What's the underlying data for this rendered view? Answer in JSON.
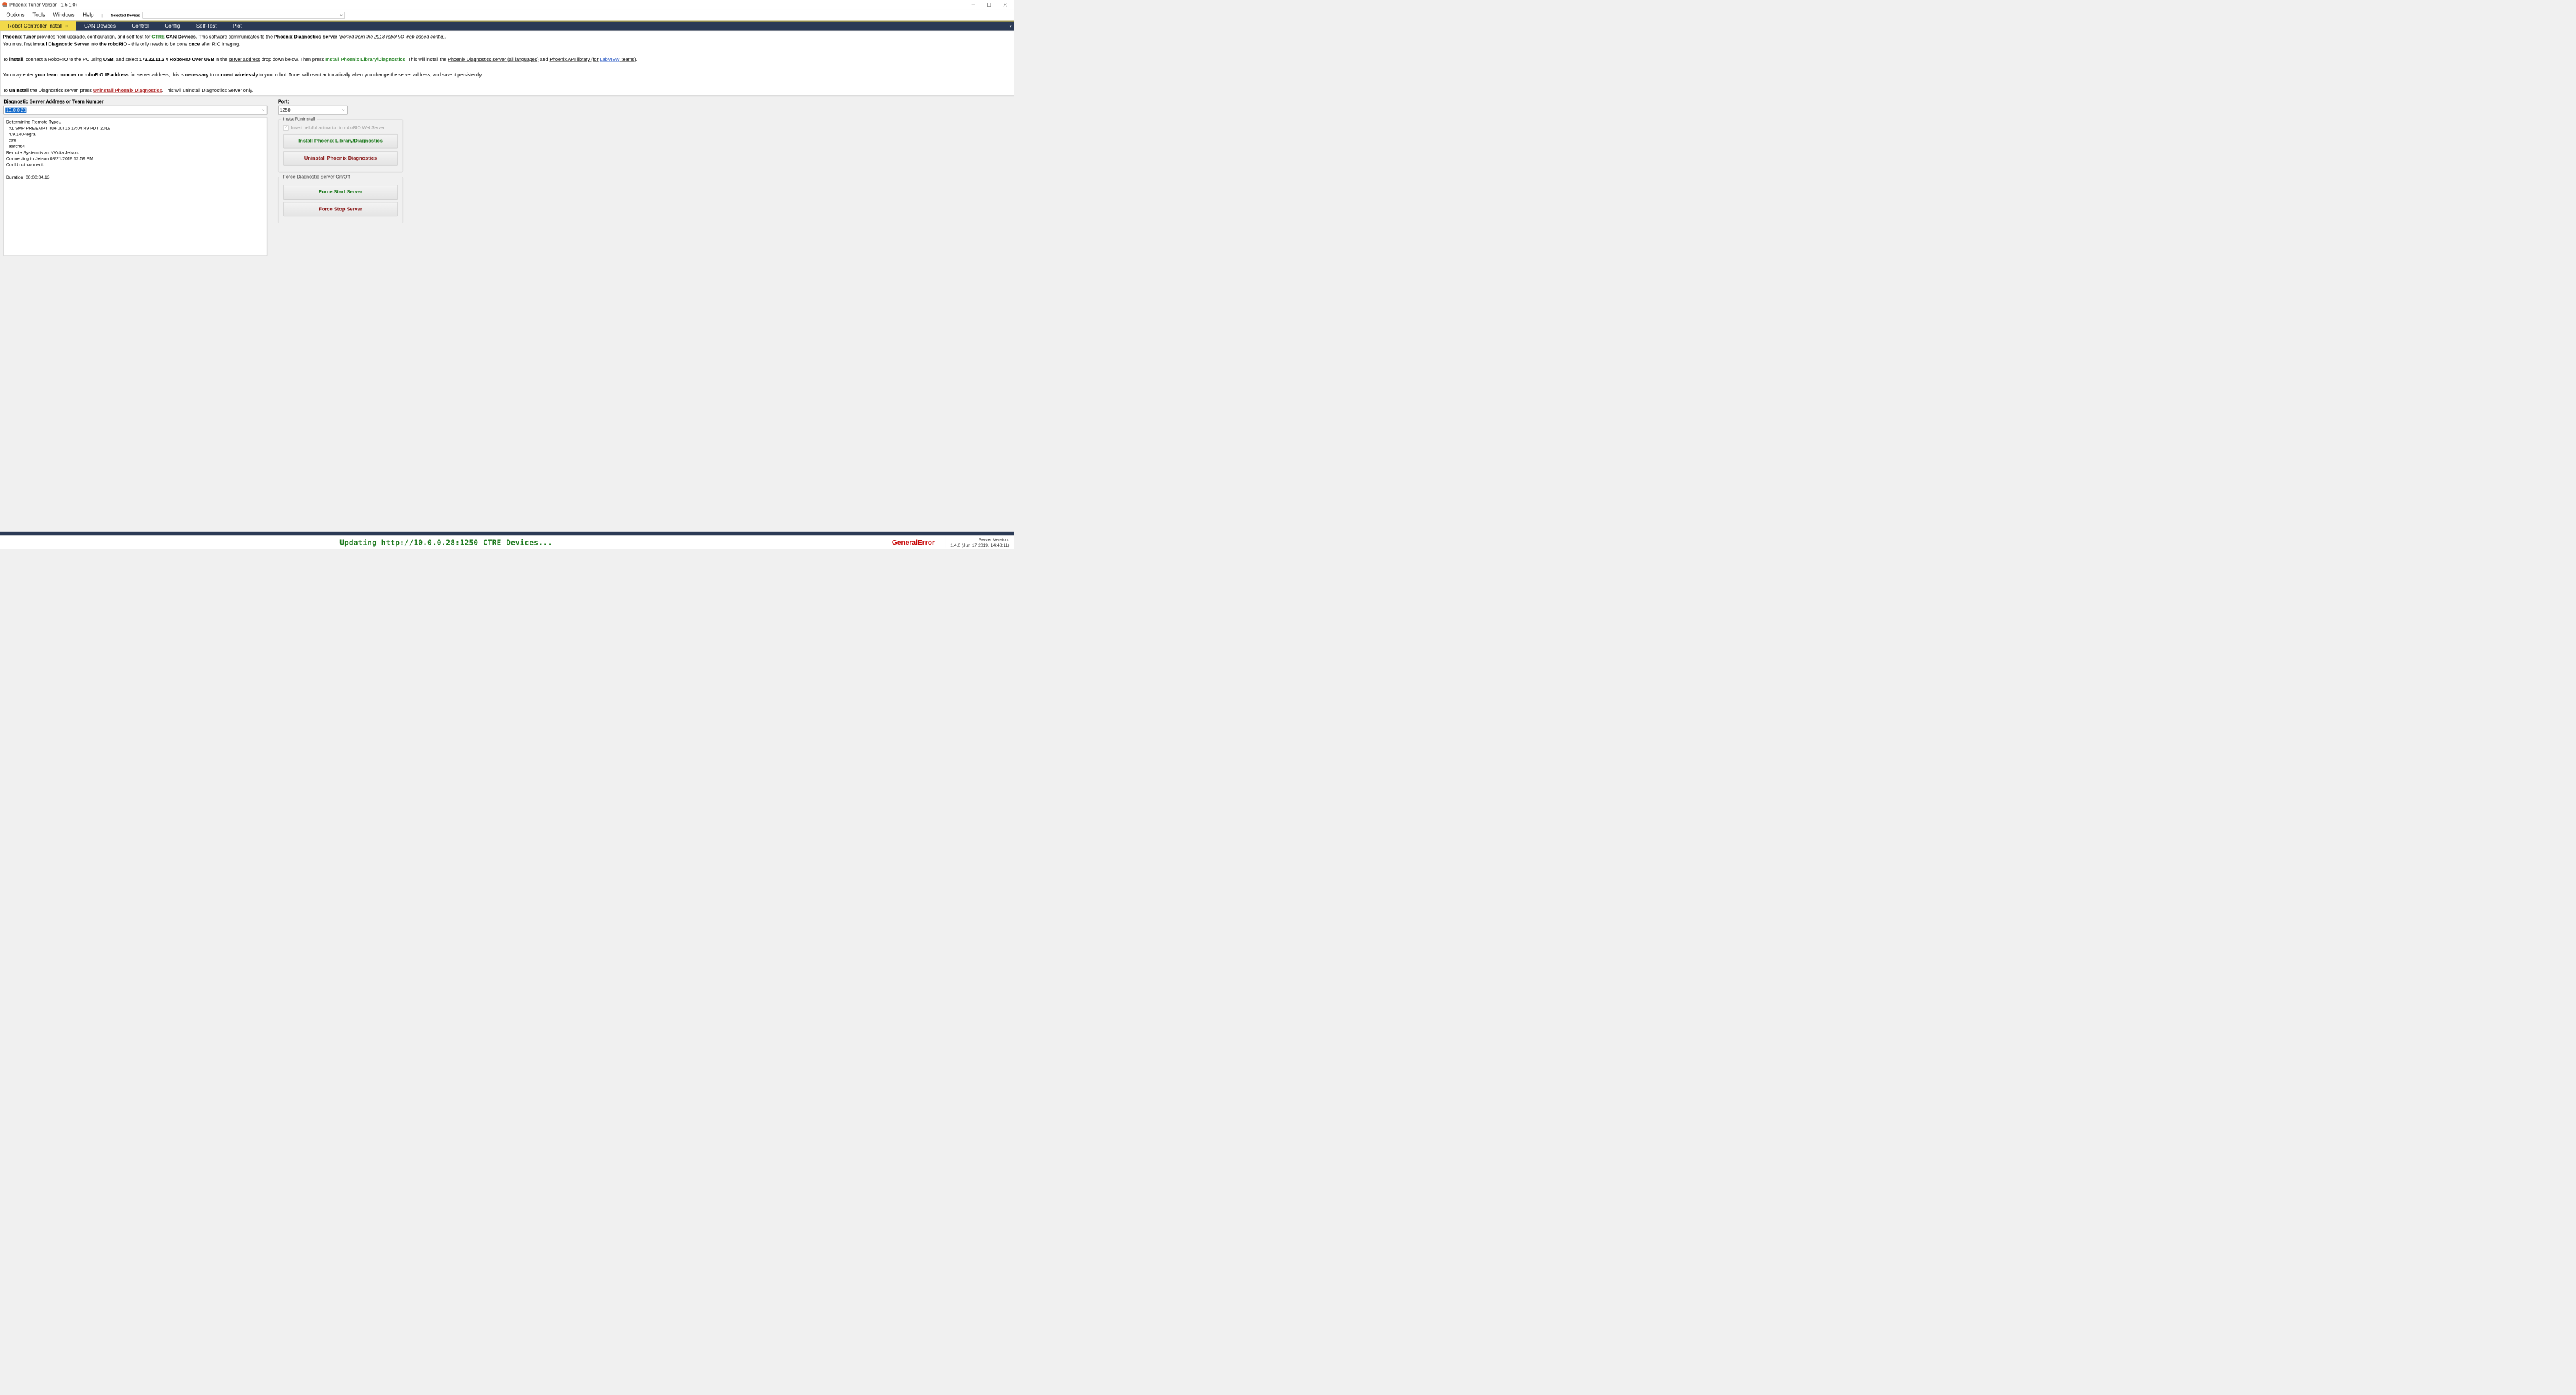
{
  "window": {
    "title": "Phoenix Tuner Version (1.5.1.0)"
  },
  "menu": {
    "options": "Options",
    "tools": "Tools",
    "windows": "Windows",
    "help": "Help",
    "selected_device_label": "Selected Device:"
  },
  "tabs": [
    {
      "label": "Robot Controller Install",
      "active": true
    },
    {
      "label": "CAN Devices"
    },
    {
      "label": "Control"
    },
    {
      "label": "Config"
    },
    {
      "label": "Self-Test"
    },
    {
      "label": "Plot"
    }
  ],
  "info": {
    "p1a": "Phoenix Tuner ",
    "p1b": "provides field-upgrade, configuration, and self-test for ",
    "p1c_green": "CTRE",
    "p1d": " CAN Devices",
    "p1e": ".  This software communicates to the ",
    "p1f": "Phoenix Diagnostics Server ",
    "p1g_i": "(ported from the 2018 roboRIO web-based config).",
    "p2a": "You must first ",
    "p2b": "install Diagnostic Server ",
    "p2c": "into ",
    "p2d": "the roboRIO",
    "p2e": " - this only needs to be done ",
    "p2f": "once ",
    "p2g": "after RIO imaging.",
    "p3a": "To ",
    "p3b": "install",
    "p3c": ", connect a RoboRIO to the PC using ",
    "p3d": "USB",
    "p3e": ", and select ",
    "p3f": "172.22.11.2 # RoboRIO Over USB ",
    "p3g": "in the ",
    "p3h_u": "server address",
    "p3i": " drop down below.  Then press ",
    "p3j_green": "Install Phoenix Library/Diagnostics",
    "p3k": ".  This will install the ",
    "p3l_u": "Phoenix Diagnostics server (all languages)",
    "p3m": " and ",
    "p3n_u": "Phoenix API library (for",
    "p3o_blue": "LabVIEW",
    "p3p_u": " teams)",
    "p3q": ".",
    "p4a": "You may enter ",
    "p4b": "your team number or roboRIO IP address ",
    "p4c": "for server address, this is ",
    "p4d": "necessary ",
    "p4e": "to ",
    "p4f": "connect wirelessly ",
    "p4g": "to your robot.  Tuner will react automatically when you change the server address, and save it persistently.",
    "p5a": "To ",
    "p5b": "uninstall ",
    "p5c": "the Diagnostics server, press ",
    "p5d_red": "Uninstall Phoenix Diagnostics",
    "p5e": ".  This will uninstall Diagnostics Server only."
  },
  "conn": {
    "addr_label": "Diagnostic Server Address or Team Number",
    "addr_value": "10.0.0.28",
    "port_label": "Port:",
    "port_value": "1250"
  },
  "fieldsets": {
    "install_legend": "Install/Uninstall",
    "chk_label": "Insert helpful animation in roboRIO WebServer",
    "btn_install": "Install Phoenix Library/Diagnostics",
    "btn_uninstall": "Uninstall Phoenix Diagnostics",
    "force_legend": "Force Diagnostic Server On/Off",
    "btn_force_start": "Force Start Server",
    "btn_force_stop": "Force Stop Server"
  },
  "log": "Determining Remote Type...\n  #1 SMP PREEMPT Tue Jul 16 17:04:49 PDT 2019\n  4.9.140-tegra\n  ctre\n  aarch64\nRemote System is an NVidia Jetson.\nConnecting to Jetson 08/21/2019 12:59 PM\nCould not connect.\n\nDuration: 00:00:04.13",
  "status": {
    "center": "Updating http://10.0.0.28:1250 CTRE Devices...",
    "badge": "GeneralError",
    "server_version_label": "Server Version:",
    "server_version": "1.4.0 (Jun 17 2019, 14:48:11)"
  }
}
